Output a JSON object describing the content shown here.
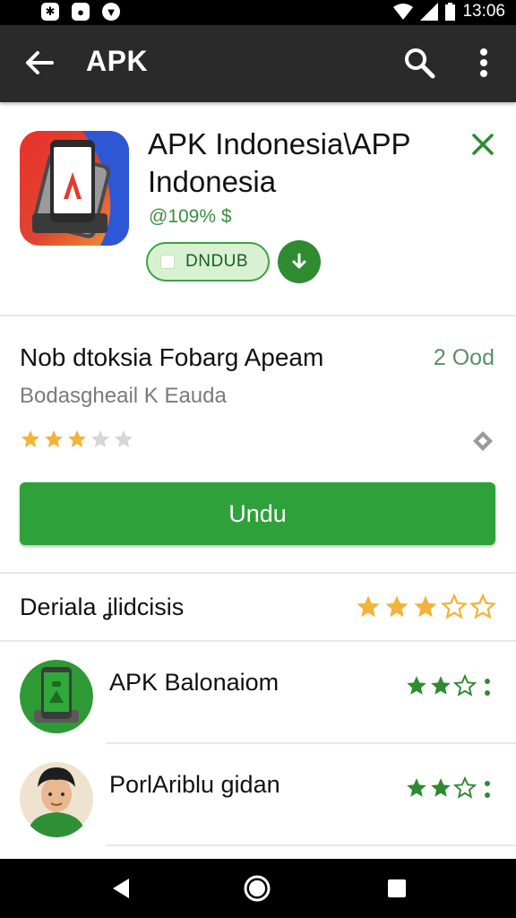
{
  "status_bar": {
    "time": "13:06",
    "icons": [
      "puzzle-icon",
      "record-icon",
      "shield-icon",
      "wifi-icon",
      "signal-icon",
      "battery-icon"
    ]
  },
  "app_bar": {
    "title": "APK",
    "icons": [
      "back-arrow-icon",
      "search-icon",
      "more-vert-icon"
    ]
  },
  "app_header": {
    "title": "APK Indonesia\\APP Indonesia",
    "size_text": "@109% $",
    "pill_label": "DNDUB",
    "icons": [
      "app-icon",
      "close-icon",
      "download-icon"
    ]
  },
  "info": {
    "title": "Nob dtoksia Fobarg Apeam",
    "value": "2 Ood",
    "subtitle": "Bodasgheail K Eauda",
    "rating": 3,
    "max_rating": 5,
    "action_icon": "share-diamond-icon"
  },
  "main_button": {
    "label": "Undu"
  },
  "section": {
    "title": "Deriala ʝlidcisis",
    "rating": 3,
    "max_rating": 5
  },
  "list": [
    {
      "name": "APK Balonaiom",
      "rating": 2,
      "max_rating": 3,
      "avatar_icon": "phone-avatar-icon"
    },
    {
      "name": "PorlAriblu ɡidan",
      "rating": 2,
      "max_rating": 3,
      "avatar_icon": "person-avatar-icon"
    }
  ],
  "nav_bar": {
    "icons": [
      "back-triangle-icon",
      "home-circle-icon",
      "recents-square-icon"
    ]
  },
  "colors": {
    "accent_green": "#2ea13a",
    "dark_green": "#2e8b2f",
    "star_gold": "#f2b33a",
    "app_bar": "#2a2a2a"
  }
}
